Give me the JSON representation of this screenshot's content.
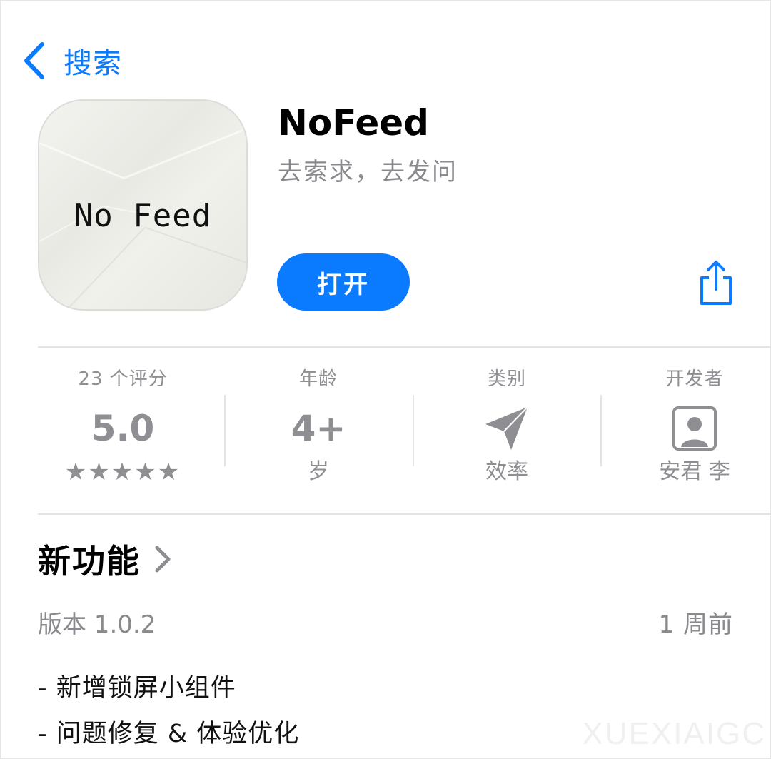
{
  "nav": {
    "back_label": "搜索",
    "back_icon": "chevron-left-icon"
  },
  "app": {
    "icon_text": "No Feed",
    "title": "NoFeed",
    "subtitle": "去索求，去发问",
    "open_label": "打开",
    "share_icon": "share-icon"
  },
  "info": {
    "ratings": {
      "head": "23 个评分",
      "value": "5.0",
      "stars": "★★★★★",
      "star_count": 5
    },
    "age": {
      "head": "年龄",
      "value": "4+",
      "sub": "岁"
    },
    "category": {
      "head": "类别",
      "sub": "效率",
      "icon": "paper-plane-icon"
    },
    "developer": {
      "head": "开发者",
      "sub": "安君 李",
      "icon": "person-portrait-icon"
    }
  },
  "whats_new": {
    "title": "新功能",
    "version": "版本 1.0.2",
    "ago": "1 周前",
    "notes": [
      "- 新增锁屏小组件",
      "- 问题修复 & 体验优化"
    ]
  },
  "watermark": "XUEXIAIGC",
  "colors": {
    "accent": "#0a7aff",
    "secondary": "#8e8e93"
  }
}
